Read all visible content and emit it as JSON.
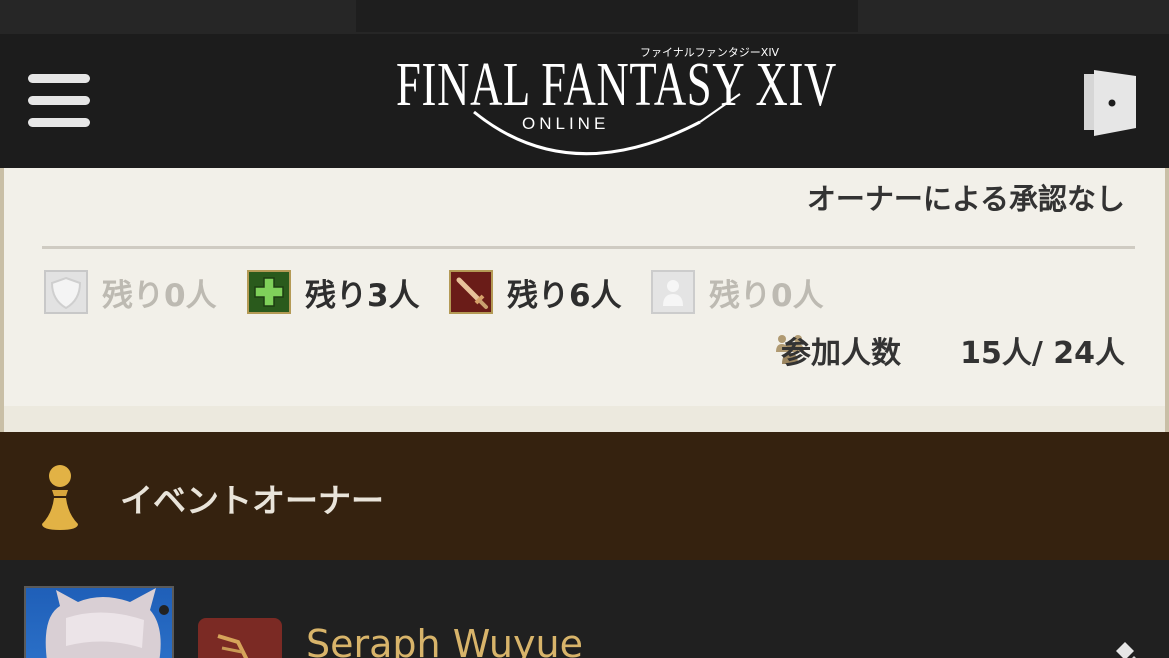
{
  "header": {
    "logo_subtitle": "ファイナルファンタジーXIV",
    "logo_title": "FINAL FANTASY XIV",
    "logo_online": "ONLINE",
    "menu_icon": "hamburger-menu-icon",
    "exit_icon": "exit-door-icon"
  },
  "recruitment": {
    "approval_text": "オーナーによる承認なし",
    "roles": [
      {
        "icon": "tank-shield-icon",
        "label": "残り0人",
        "active": false
      },
      {
        "icon": "healer-cross-icon",
        "label": "残り3人",
        "active": true
      },
      {
        "icon": "dps-sword-icon",
        "label": "残り6人",
        "active": true
      },
      {
        "icon": "any-role-icon",
        "label": "残り0人",
        "active": false
      }
    ],
    "participants_label": "参加人数",
    "participants_count": "15人/ 24人"
  },
  "owner_section": {
    "title": "イベントオーナー",
    "icon": "owner-pawn-icon"
  },
  "owner": {
    "name": "Seraph Wuyue",
    "job_icon": "job-icon"
  },
  "colors": {
    "header_bg": "#1c1c1c",
    "panel_bg": "#f2f0e9",
    "owner_band_bg": "#35220f",
    "owner_name": "#d8b46a"
  }
}
